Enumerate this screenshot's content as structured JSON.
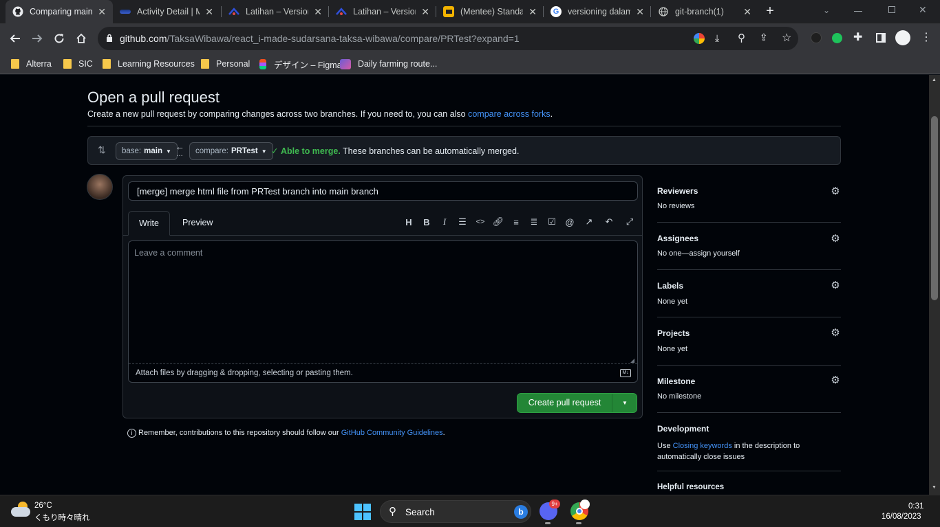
{
  "tabs": [
    {
      "title": "Comparing main...",
      "icon": "github-icon"
    },
    {
      "title": "Activity Detail | M...",
      "icon": "alterra-icon"
    },
    {
      "title": "Latihan – Version...",
      "icon": "alterra-icon"
    },
    {
      "title": "Latihan – Version...",
      "icon": "alterra-icon"
    },
    {
      "title": "(Mentee) Standar...",
      "icon": "slides-icon"
    },
    {
      "title": "versioning dalam...",
      "icon": "google-icon"
    },
    {
      "title": "git-branch(1)",
      "icon": "globe-icon"
    }
  ],
  "tab_close": "✕",
  "new_tab": "+",
  "address": {
    "host": "github.com",
    "path": "/TaksaWibawa/react_i-made-sudarsana-taksa-wibawa/compare/PRTest?expand=1"
  },
  "bookmarks": [
    {
      "label": "Alterra",
      "icon": "folder-icon"
    },
    {
      "label": "SIC",
      "icon": "folder-icon"
    },
    {
      "label": "Learning Resources",
      "icon": "folder-icon"
    },
    {
      "label": "Personal",
      "icon": "folder-icon"
    },
    {
      "label": "デザイン – Figma",
      "icon": "figma-icon"
    },
    {
      "label": "Daily farming route...",
      "icon": "farm-icon"
    }
  ],
  "page": {
    "title": "Open a pull request",
    "subtitle_before": "Create a new pull request by comparing changes across two branches. If you need to, you can also ",
    "subtitle_link": "compare across forks",
    "subtitle_after": ".",
    "base_label": "base:",
    "base_value": "main",
    "compare_label": "compare:",
    "compare_value": "PRTest",
    "merge_status": "Able to merge.",
    "merge_text": "These branches can be automatically merged.",
    "pr_title": "[merge] merge html file from PRTest branch into main branch",
    "tab_write": "Write",
    "tab_preview": "Preview",
    "comment_placeholder": "Leave a comment",
    "attach_text": "Attach files by dragging & dropping, selecting or pasting them.",
    "create_button": "Create pull request",
    "remember_before": "Remember, contributions to this repository should follow our ",
    "remember_link": "GitHub Community Guidelines",
    "remember_after": "."
  },
  "sidebar": {
    "reviewers": {
      "heading": "Reviewers",
      "value": "No reviews"
    },
    "assignees": {
      "heading": "Assignees",
      "value": "No one—assign yourself"
    },
    "labels": {
      "heading": "Labels",
      "value": "None yet"
    },
    "projects": {
      "heading": "Projects",
      "value": "None yet"
    },
    "milestone": {
      "heading": "Milestone",
      "value": "No milestone"
    },
    "development": {
      "heading": "Development",
      "before": "Use ",
      "link": "Closing keywords",
      "after": " in the description to automatically close issues"
    },
    "helpful": {
      "heading": "Helpful resources"
    }
  },
  "taskbar": {
    "temp": "26°C",
    "weather": "くもり時々晴れ",
    "search": "Search",
    "time": "0:31",
    "date": "16/08/2023",
    "discord_badge": "9+"
  },
  "colors": {
    "accent_link": "#4493f8",
    "merge_green": "#3fb950",
    "button_green": "#238636"
  }
}
